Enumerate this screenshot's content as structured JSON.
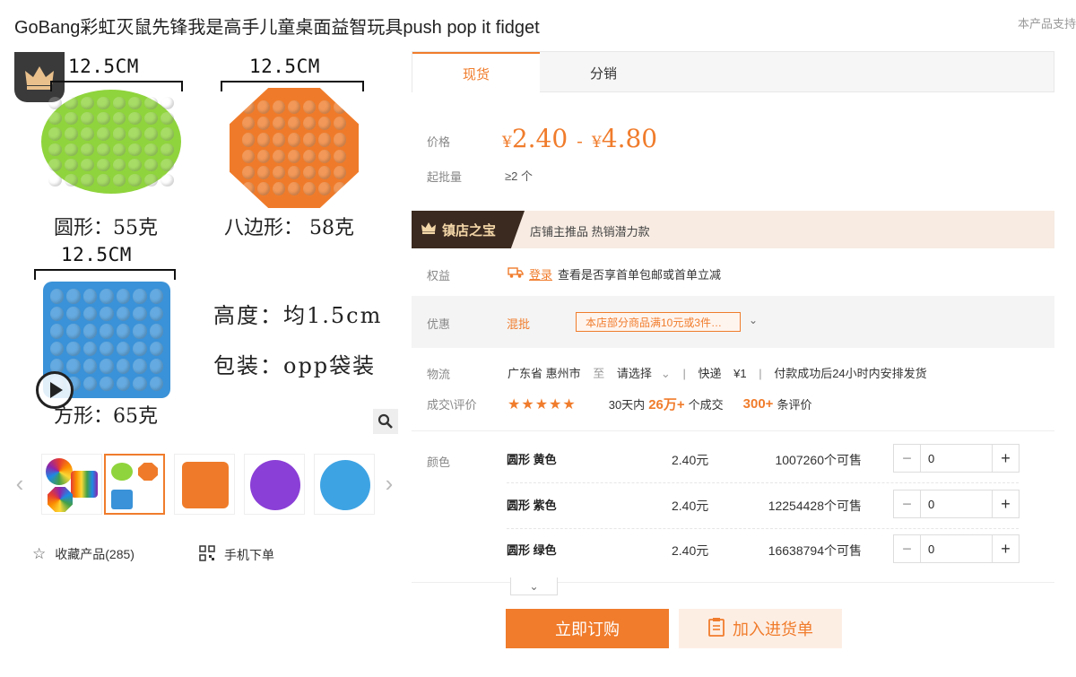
{
  "title": "GoBang彩虹灭鼠先锋我是高手儿童桌面益智玩具push pop it fidget",
  "corner_link": "本产品支持",
  "main_image": {
    "dim_top_left": "12.5CM",
    "dim_top_right": "12.5CM",
    "dim_mid": "12.5CM",
    "label_round": "圆形：55克",
    "label_oct": "八边形：  58克",
    "label_square": "方形：65克",
    "label_height": "高度：均1.5cm",
    "label_pack": "包装：opp袋装"
  },
  "left_actions": {
    "favorite": "收藏产品(285)",
    "mobile": "手机下单"
  },
  "tabs": [
    "现货",
    "分销"
  ],
  "price": {
    "label": "价格",
    "currency": "¥",
    "low": "2.40",
    "high": "4.80",
    "sep": "-"
  },
  "moq": {
    "label": "起批量",
    "value": "≥2 个"
  },
  "treasure": {
    "badge": "镇店之宝",
    "text": "店铺主推品  热销潜力款"
  },
  "benefit": {
    "label": "权益",
    "login": "登录",
    "text": "查看是否享首单包邮或首单立减"
  },
  "promo": {
    "label": "优惠",
    "mix": "混批",
    "tag": "本店部分商品满10元或3件…"
  },
  "logistics": {
    "label": "物流",
    "origin": "广东省 惠州市",
    "to": "至",
    "dest": "请选择",
    "method": "快递",
    "fee": "¥1",
    "ship_note": "付款成功后24小时内安排发货"
  },
  "deals": {
    "label": "成交\\评价",
    "stars": "★★★★★",
    "prefix": "30天内",
    "count": "26万+",
    "count_suffix": "个成交",
    "reviews": "300+",
    "reviews_suffix": "条评价"
  },
  "sku": {
    "label": "颜色",
    "rows": [
      {
        "name": "圆形 黄色",
        "price": "2.40元",
        "stock": "1007260个可售",
        "qty": "0"
      },
      {
        "name": "圆形 紫色",
        "price": "2.40元",
        "stock": "12254428个可售",
        "qty": "0"
      },
      {
        "name": "圆形 绿色",
        "price": "2.40元",
        "stock": "16638794个可售",
        "qty": "0"
      }
    ]
  },
  "buttons": {
    "buy": "立即订购",
    "cart": "加入进货单"
  },
  "colors": {
    "accent": "#f07c2c",
    "green_toy": "#8fd43c",
    "orange_toy": "#ef7b2a",
    "blue_toy": "#3a92d8",
    "purple_toy": "#8a3fd6"
  }
}
